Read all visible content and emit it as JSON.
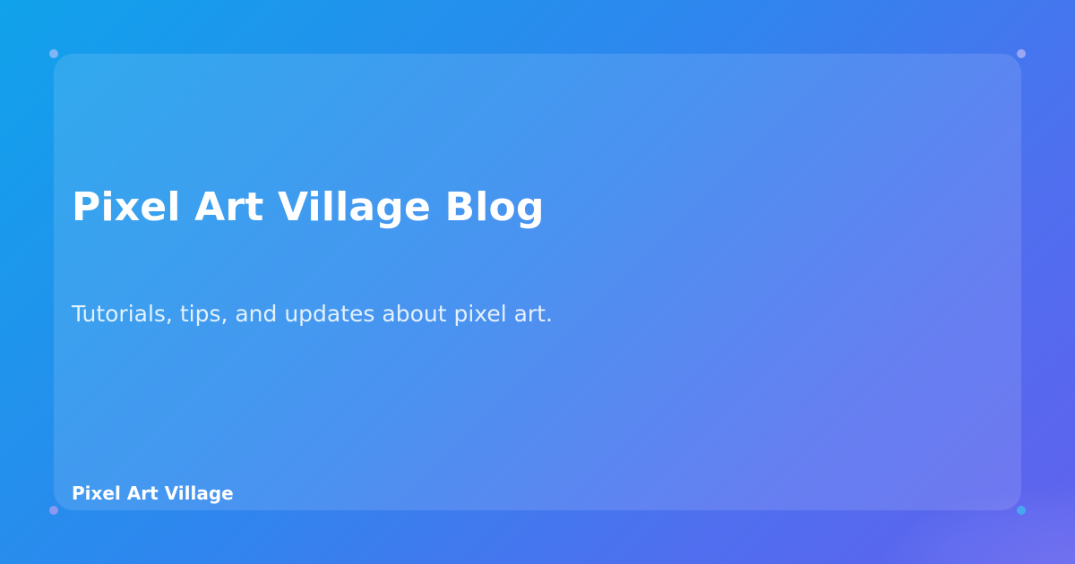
{
  "blog": {
    "title": "Pixel Art Village Blog",
    "subtitle": "Tutorials, tips, and updates about pixel art.",
    "site_name": "Pixel Art Village"
  },
  "colors": {
    "gradient_start": "#10a2eb",
    "gradient_end": "#6161ee",
    "text": "#ffffff"
  }
}
